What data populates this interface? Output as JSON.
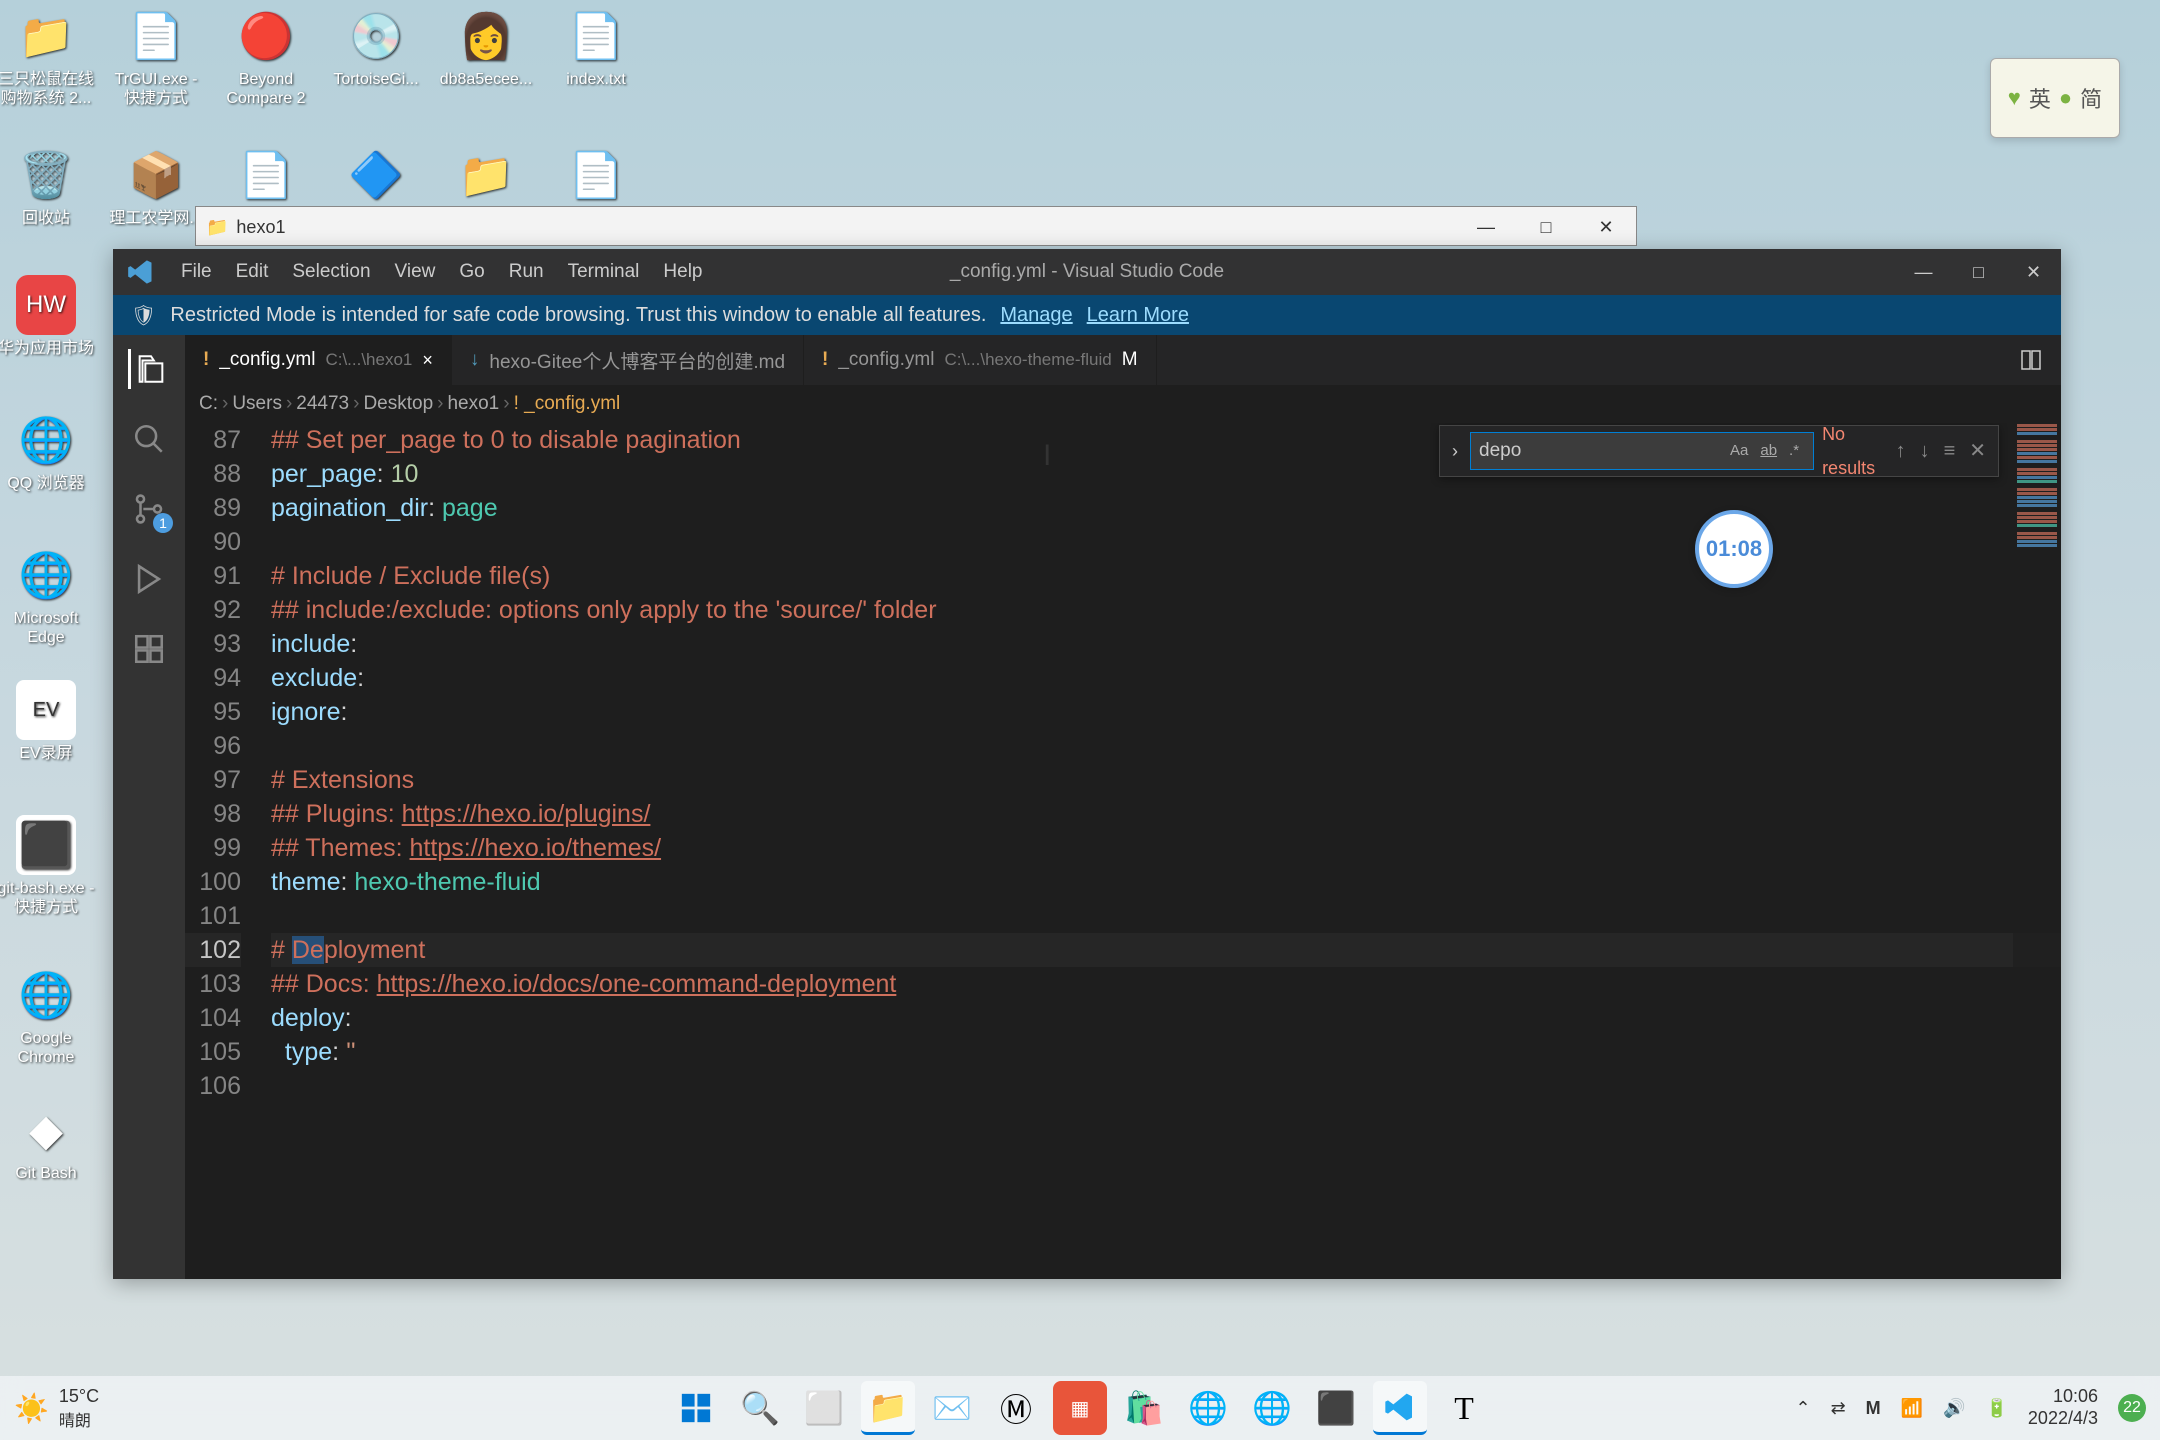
{
  "desktop_icons": {
    "row1": [
      {
        "label": "三只松鼠在线购物系统 2...",
        "glyph": "📁"
      },
      {
        "label": "TrGUI.exe - 快捷方式",
        "glyph": "📄"
      },
      {
        "label": "Beyond Compare 2",
        "glyph": "🔴"
      },
      {
        "label": "TortoiseGi...",
        "glyph": "💿"
      },
      {
        "label": "db8a5ecee...",
        "glyph": "👩"
      },
      {
        "label": "index.txt",
        "glyph": "📄"
      }
    ],
    "row2": [
      {
        "label": "回收站",
        "glyph": "🗑️"
      },
      {
        "label": "理工农学网...",
        "glyph": "📦"
      },
      {
        "label": "",
        "glyph": "📄"
      },
      {
        "label": "",
        "glyph": "🔷"
      },
      {
        "label": "",
        "glyph": "📁"
      },
      {
        "label": "",
        "glyph": "📄"
      }
    ],
    "col": [
      {
        "label": "华为应用市场",
        "color": "#e84545"
      },
      {
        "label": "QQ 浏览器",
        "color": "#1e9fff"
      },
      {
        "label": "Microsoft Edge",
        "color": "#2c7a7b"
      },
      {
        "label": "EV录屏",
        "color": "#fff"
      },
      {
        "label": "git-bash.exe - 快捷方式",
        "color": "#fff"
      },
      {
        "label": "Google Chrome",
        "color": "#fff"
      },
      {
        "label": "Git Bash",
        "color": "#fff"
      }
    ]
  },
  "explorer": {
    "title": "hexo1",
    "controls": {
      "min": "—",
      "max": "□",
      "close": "✕"
    }
  },
  "vscode": {
    "menu": [
      "File",
      "Edit",
      "Selection",
      "View",
      "Go",
      "Run",
      "Terminal",
      "Help"
    ],
    "title": "_config.yml - Visual Studio Code",
    "restricted": {
      "text": "Restricted Mode is intended for safe code browsing. Trust this window to enable all features.",
      "manage": "Manage",
      "learn": "Learn More"
    },
    "tabs": [
      {
        "icon": "!",
        "name": "_config.yml",
        "path": "C:\\...\\hexo1",
        "active": true,
        "close": "×"
      },
      {
        "icon": "↓",
        "name": "hexo-Gitee个人博客平台的创建.md",
        "md": true
      },
      {
        "icon": "!",
        "name": "_config.yml",
        "path": "C:\\...\\hexo-theme-fluid",
        "dirty": "M"
      }
    ],
    "breadcrumb": [
      "C:",
      "Users",
      "24473",
      "Desktop",
      "hexo1",
      "!  _config.yml"
    ],
    "find": {
      "value": "depo",
      "results": "No results"
    },
    "activity_badge": "1",
    "lines": {
      "start": 87,
      "87": {
        "pre": "## Set per_page to 0 to disable pagination"
      },
      "88_prop": "per_page",
      "88_val": "10",
      "89_prop": "pagination_dir",
      "89_val": "page",
      "91": "# Include / Exclude file(s)",
      "92": "## include:/exclude: options only apply to the 'source/' folder",
      "93_prop": "include",
      "94_prop": "exclude",
      "95_prop": "ignore",
      "97": "# Extensions",
      "98_pre": "## Plugins: ",
      "98_link": "https://hexo.io/plugins/",
      "99_pre": "## Themes: ",
      "99_link": "https://hexo.io/themes/",
      "100_prop": "theme",
      "100_val": "hexo-theme-fluid",
      "102_pre": "# ",
      "102_sel": "De",
      "102_post": "ployment",
      "103_pre": "## Docs: ",
      "103_link": "https://hexo.io/docs/one-command-deployment",
      "104_prop": "deploy",
      "105_prop": "type",
      "105_val": "''"
    }
  },
  "timer": "01:08",
  "ime": {
    "lang1": "英",
    "lang2": "简"
  },
  "taskbar": {
    "weather_temp": "15°C",
    "weather_desc": "晴朗",
    "time": "10:06",
    "date": "2022/4/3",
    "badge": "22"
  }
}
